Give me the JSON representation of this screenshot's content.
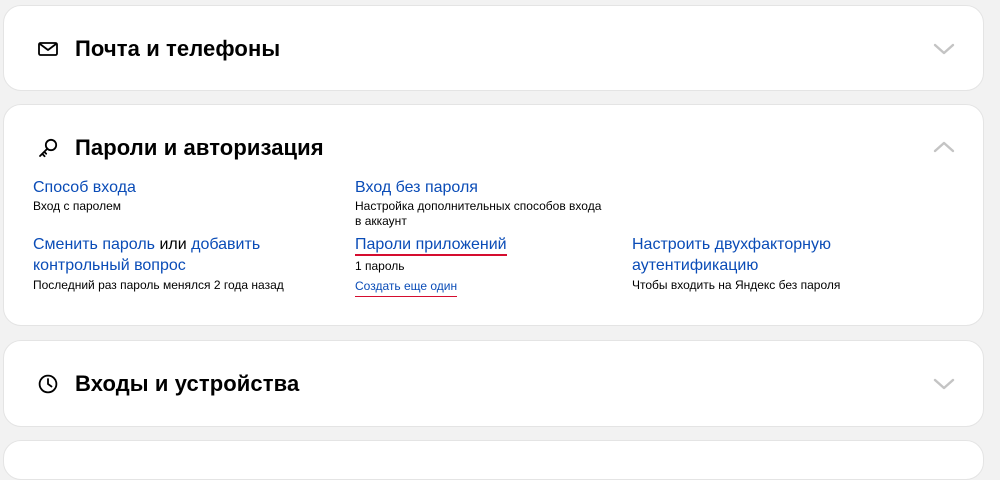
{
  "sections": {
    "mail": {
      "title": "Почта и телефоны",
      "icon": "envelope-icon",
      "chevron": "chevron-down-icon"
    },
    "passwords": {
      "title": "Пароли и авторизация",
      "icon": "key-icon",
      "chevron": "chevron-up-icon",
      "login_method": {
        "link": "Способ входа",
        "desc": "Вход с паролем"
      },
      "passwordless": {
        "link": "Вход без пароля",
        "desc": "Настройка дополнительных способов входа в аккаунт"
      },
      "change_password": {
        "link1": "Сменить пароль",
        "joiner": " или ",
        "link2_part1": "добавить",
        "link2_part2": "контрольный вопрос",
        "desc": "Последний раз пароль менялся 2 года назад"
      },
      "app_passwords": {
        "link": "Пароли приложений",
        "count": "1 пароль",
        "create_link": "Создать еще один"
      },
      "two_factor": {
        "link_line1": "Настроить двухфакторную",
        "link_line2": "аутентификацию",
        "desc": "Чтобы входить на Яндекс без пароля"
      }
    },
    "logins": {
      "title": "Входы и устройства",
      "icon": "clock-icon",
      "chevron": "chevron-down-icon"
    }
  },
  "colors": {
    "link": "#0a4cb7",
    "highlight": "#d50d2f",
    "chevron": "#c4c4c4"
  }
}
